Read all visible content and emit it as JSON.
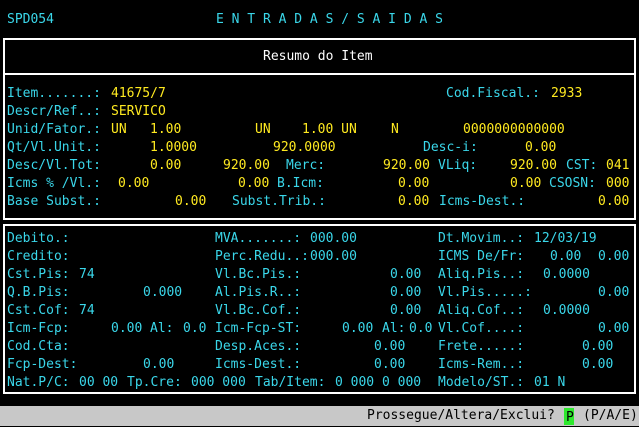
{
  "header": {
    "program": "SPD054",
    "title": "E N T R A D A S / S A I D A S"
  },
  "section_title": "Resumo do Item",
  "top": {
    "item_label": "Item.......:",
    "item_value": "41675/7",
    "cod_fiscal_label": "Cod.Fiscal.:",
    "cod_fiscal_value": "2933",
    "descr_label": "Descr/Ref..:",
    "descr_value": "SERVICO",
    "unid_label": "Unid/Fator.:",
    "unid_1": "UN",
    "fator_1": "1.00",
    "unid_2": "UN",
    "fator_2": "1.00 UN",
    "flag_n": "N",
    "unid_code": "0000000000000",
    "qt_label": "Qt/Vl.Unit.:",
    "qt_value": "1.0000",
    "vl_unit_value": "920.0000",
    "desc_i_label": "Desc-i:",
    "desc_i_value": "0.00",
    "desc_tot_label": "Desc/Vl.Tot:",
    "desc_value": "0.00",
    "vl_tot_value": "920.00",
    "merc_label": "Merc:",
    "merc_value": "920.00",
    "vliq_label": "VLiq:",
    "vliq_value": "920.00",
    "cst_label": "CST:",
    "cst_value": "041",
    "icms_label": "Icms % /Vl.:",
    "icms_pct": "0.00",
    "icms_vl": "0.00",
    "bicm_label": "B.Icm:",
    "bicm_value": "0.00",
    "bicm_value2": "0.00",
    "csosn_label": "CSOSN:",
    "csosn_value": "000",
    "base_subst_label": "Base Subst.:",
    "base_subst_value": "0.00",
    "subst_trib_label": "Subst.Trib.:",
    "subst_trib_value": "0.00",
    "icms_dest_label": "Icms-Dest.:",
    "icms_dest_value": "0.00"
  },
  "bottom": {
    "debito_label": "Debito.:",
    "mva_label": "MVA.......:",
    "mva_value": "000.00",
    "dt_movim_label": "Dt.Movim..:",
    "dt_movim_value": "12/03/19",
    "credito_label": "Credito:",
    "perc_redu_label": "Perc.Redu..:",
    "perc_redu_value": "000.00",
    "icms_defr_label": "ICMS De/Fr:",
    "icms_de_value": "0.00",
    "icms_fr_value": "0.00",
    "cst_pis_label": "Cst.Pis:",
    "cst_pis_value": "74",
    "vl_bc_pis_label": "Vl.Bc.Pis.:",
    "vl_bc_pis_value": "0.00",
    "aliq_pis_label": "Aliq.Pis..:",
    "aliq_pis_value": "0.0000",
    "qb_pis_label": "Q.B.Pis:",
    "qb_pis_value": "0.000",
    "al_pis_r_label": "Al.Pis.R..:",
    "al_pis_r_value": "0.00",
    "vl_pis_label": "Vl.Pis.....:",
    "vl_pis_value": "0.00",
    "cst_cof_label": "Cst.Cof:",
    "cst_cof_value": "74",
    "vl_bc_cof_label": "Vl.Bc.Cof.:",
    "vl_bc_cof_value": "0.00",
    "aliq_cof_label": "Aliq.Cof..:",
    "aliq_cof_value": "0.0000",
    "icm_fcp_label": "Icm-Fcp:",
    "icm_fcp_value": "0.00",
    "al_label": "Al:",
    "al_value": "0.0",
    "icm_fcp_st_label": "Icm-Fcp-ST:",
    "icm_fcp_st_value": "0.00",
    "al2_label": "Al:",
    "al2_value": "0.0",
    "vl_cof_label": "Vl.Cof....:",
    "vl_cof_value": "0.00",
    "cod_cta_label": "Cod.Cta:",
    "desp_aces_label": "Desp.Aces.:",
    "desp_aces_value": "0.00",
    "frete_label": "Frete.....:",
    "frete_value": "0.00",
    "fcp_dest_label": "Fcp-Dest:",
    "fcp_dest_value": "0.00",
    "icms_dest2_label": "Icms-Dest.:",
    "icms_dest2_value": "0.00",
    "icms_rem_label": "Icms-Rem..:",
    "icms_rem_value": "0.00",
    "nat_label": "Nat.P/C:",
    "nat_value": "00 00",
    "tp_cre_label": "Tp.Cre:",
    "tp_cre_value": "000 000",
    "tab_item_label": "Tab/Item:",
    "tab_item_value": "0 000 0 000",
    "modelo_label": "Modelo/ST.:",
    "modelo_value": "01 N"
  },
  "status": {
    "prompt": "Prossegue/Altera/Exclui?",
    "input_value": "P",
    "options": "(P/A/E)"
  }
}
